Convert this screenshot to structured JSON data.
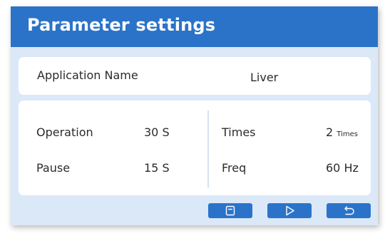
{
  "header": {
    "title": "Parameter settings"
  },
  "application": {
    "label": "Application Name",
    "value": "Liver"
  },
  "params": {
    "operation": {
      "label": "Operation",
      "value": "30 S"
    },
    "pause": {
      "label": "Pause",
      "value": "15 S"
    },
    "times": {
      "label": "Times",
      "value": "2",
      "unit": "Times"
    },
    "freq": {
      "label": "Freq",
      "value": "60 Hz"
    }
  },
  "toolbar": {
    "buttons": [
      {
        "icon": "save-icon"
      },
      {
        "icon": "play-icon"
      },
      {
        "icon": "return-icon"
      }
    ]
  },
  "colors": {
    "header": "#2b73c8",
    "background": "#dbe8f7",
    "card": "#ffffff",
    "button": "#2b73c8"
  }
}
